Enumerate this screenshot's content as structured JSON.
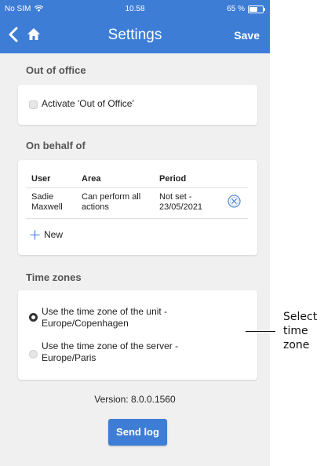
{
  "status_bar": {
    "carrier": "No SIM",
    "time": "10.58",
    "battery": "65 %"
  },
  "nav": {
    "title": "Settings",
    "save_label": "Save",
    "icons": [
      "chevron-left-icon",
      "home-icon"
    ]
  },
  "out_of_office": {
    "title": "Out of office",
    "checkbox_label": "Activate 'Out of Office'",
    "checked": false
  },
  "on_behalf": {
    "title": "On behalf of",
    "columns": [
      "User",
      "Area",
      "Period"
    ],
    "rows": [
      {
        "user": [
          "Sadie",
          "Maxwell"
        ],
        "area": [
          "Can perform all",
          "actions"
        ],
        "period": [
          "Not set -",
          "23/05/2021"
        ]
      }
    ],
    "new_label": "New"
  },
  "time_zones": {
    "title": "Time zones",
    "options": [
      {
        "lines": [
          "Use the time zone of the unit -",
          "Europe/Copenhagen"
        ],
        "selected": true
      },
      {
        "lines": [
          "Use the time zone of the server -",
          "Europe/Paris"
        ],
        "selected": false
      }
    ]
  },
  "version": "Version: 8.0.0.1560",
  "send_log_label": "Send log",
  "annotation": [
    "Select",
    "time",
    "zone"
  ],
  "colors": {
    "accent": "#3d7dd6",
    "background": "#f0f0f0",
    "card": "#ffffff"
  }
}
